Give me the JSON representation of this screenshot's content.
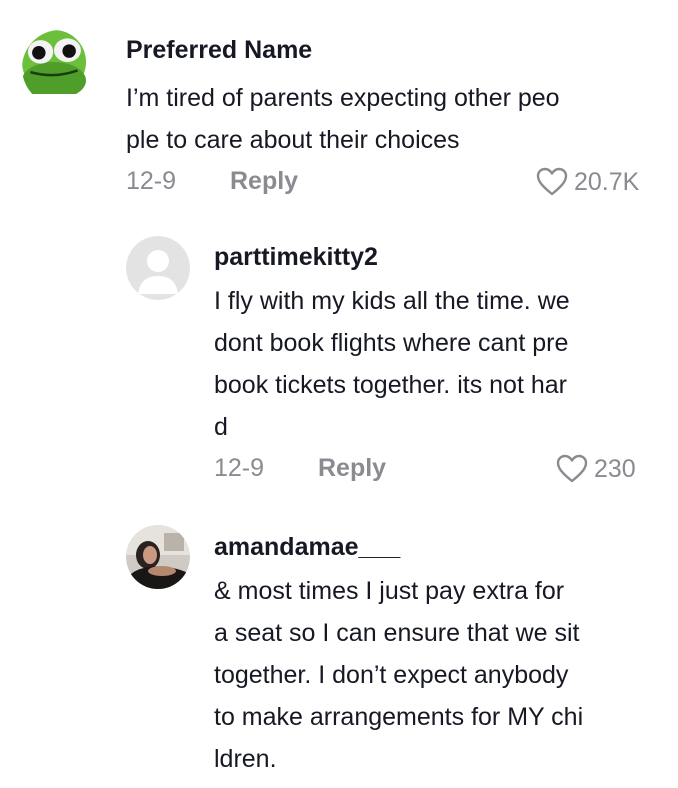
{
  "comments": [
    {
      "username": "Preferred Name",
      "lines": [
        "I’m tired of parents expecting other peo",
        "ple to care about their choices"
      ],
      "date": "12-9",
      "reply_label": "Reply",
      "likes": "20.7K",
      "avatar": "frog-face-avatar"
    },
    {
      "username": "parttimekitty2",
      "lines": [
        "I fly with my kids all the time. we",
        "dont book flights where cant pre",
        "book tickets together. its not har",
        "d"
      ],
      "date": "12-9",
      "reply_label": "Reply",
      "likes": "230",
      "avatar": "default-user-avatar"
    },
    {
      "username": "amandamae___",
      "lines": [
        "& most times I just pay extra for",
        "a seat so I can ensure that we sit",
        "together. I don’t expect anybody",
        "to make arrangements for MY chi",
        "ldren."
      ],
      "avatar": "photo-avatar"
    }
  ],
  "colors": {
    "text": "#161823",
    "muted": "#8a8b91",
    "heart_outline": "#8a8b91"
  }
}
